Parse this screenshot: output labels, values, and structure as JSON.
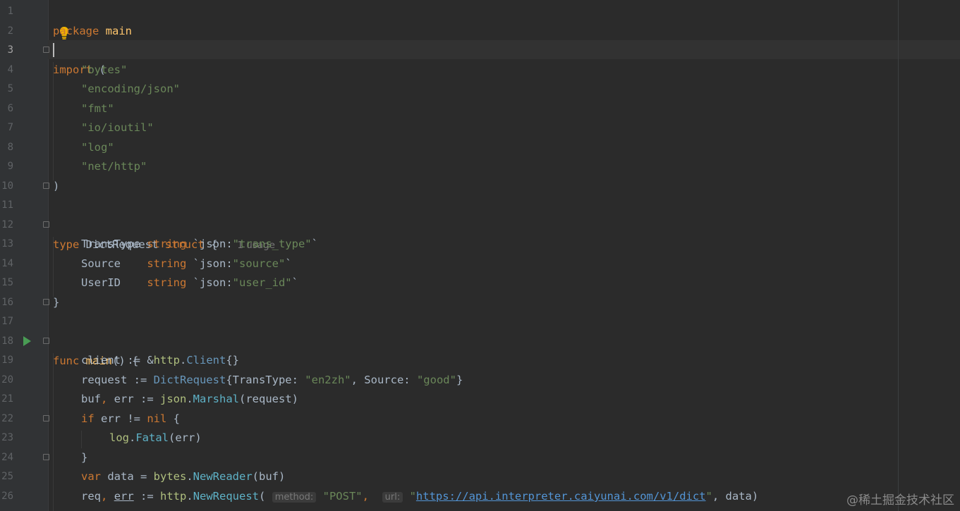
{
  "editor": {
    "line_numbers": [
      "1",
      "2",
      "3",
      "4",
      "5",
      "6",
      "7",
      "8",
      "9",
      "10",
      "11",
      "12",
      "13",
      "14",
      "15",
      "16",
      "17",
      "18",
      "19",
      "20",
      "21",
      "22",
      "23",
      "24",
      "25",
      "26"
    ],
    "l1": {
      "kw": "package",
      "name": " main"
    },
    "l3": {
      "kw": "import",
      "rest": " ("
    },
    "imports": [
      "\"bytes\"",
      "\"encoding/json\"",
      "\"fmt\"",
      "\"io/ioutil\"",
      "\"log\"",
      "\"net/http\""
    ],
    "l10": ")",
    "l12": {
      "kw1": "type",
      "name": " DictRequest ",
      "kw2": "struct",
      "brace": " {",
      "usage": "1 usage"
    },
    "fields": [
      {
        "name": "TransType ",
        "type": "string",
        "tag_open": " `json:",
        "tag_val": "\"trans_type\"",
        "tag_close": "`"
      },
      {
        "name": "Source    ",
        "type": "string",
        "tag_open": " `json:",
        "tag_val": "\"source\"",
        "tag_close": "`"
      },
      {
        "name": "UserID    ",
        "type": "string",
        "tag_open": " `json:",
        "tag_val": "\"user_id\"",
        "tag_close": "`"
      }
    ],
    "l16": "}",
    "l18": {
      "kw": "func",
      "name": " main",
      "rest": "() {"
    },
    "l19": {
      "a": "client := &",
      "pkg": "http",
      "dot": ".",
      "type": "Client",
      "b": "{}"
    },
    "l20": {
      "a": "request := ",
      "type": "DictRequest",
      "b": "{TransType: ",
      "s1": "\"en2zh\"",
      "c": ", Source: ",
      "s2": "\"good\"",
      "d": "}"
    },
    "l21": {
      "a": "buf",
      "comma": ",",
      "b": " err := ",
      "pkg": "json",
      "dot": ".",
      "fn": "Marshal",
      "c": "(request)"
    },
    "l22": {
      "kw": "if",
      "a": " err != ",
      "kw2": "nil",
      "b": " {"
    },
    "l23": {
      "pkg": "log",
      "dot": ".",
      "fn": "Fatal",
      "a": "(err)"
    },
    "l24": "}",
    "l25": {
      "kw": "var",
      "a": " data = ",
      "pkg": "bytes",
      "dot": ".",
      "fn": "NewReader",
      "b": "(buf)"
    },
    "l26": {
      "a": "req",
      "comma": ",",
      "err": "err",
      "b": " := ",
      "pkg": "http",
      "dot": ".",
      "fn": "NewRequest",
      "paren": "(",
      "hint1": "method:",
      "s1": "\"POST\"",
      "c": ",",
      "hint2": "url:",
      "q1": "\"",
      "url": "https://api.interpreter.caiyunai.com/v1/dict",
      "q2": "\"",
      "d": ", data)"
    }
  },
  "watermark": "@稀土掘金技术社区",
  "colors": {
    "background": "#2b2b2b",
    "keyword": "#cc7832",
    "string": "#6a8759",
    "function": "#ffc66d"
  }
}
